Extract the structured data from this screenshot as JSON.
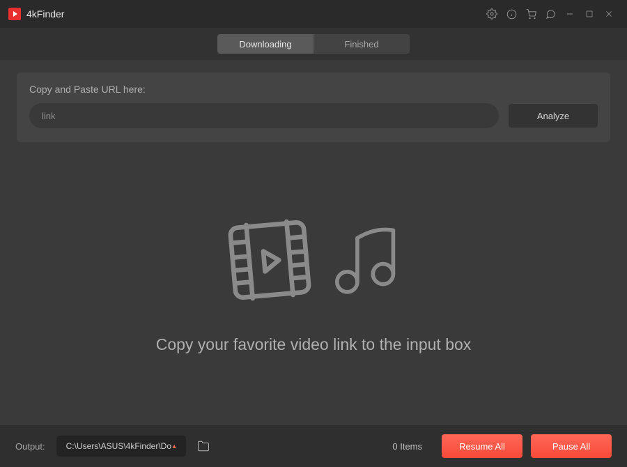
{
  "titlebar": {
    "app_name": "4kFinder"
  },
  "tabs": {
    "downloading": "Downloading",
    "finished": "Finished",
    "active": "downloading"
  },
  "url_panel": {
    "label": "Copy and Paste URL here:",
    "placeholder": "link",
    "value": "",
    "analyze_label": "Analyze"
  },
  "empty_state": {
    "message": "Copy your favorite video link to the input box"
  },
  "bottombar": {
    "output_label": "Output:",
    "output_path": "C:\\Users\\ASUS\\4kFinder\\Do",
    "items_count": "0 Items",
    "resume_label": "Resume All",
    "pause_label": "Pause All"
  }
}
